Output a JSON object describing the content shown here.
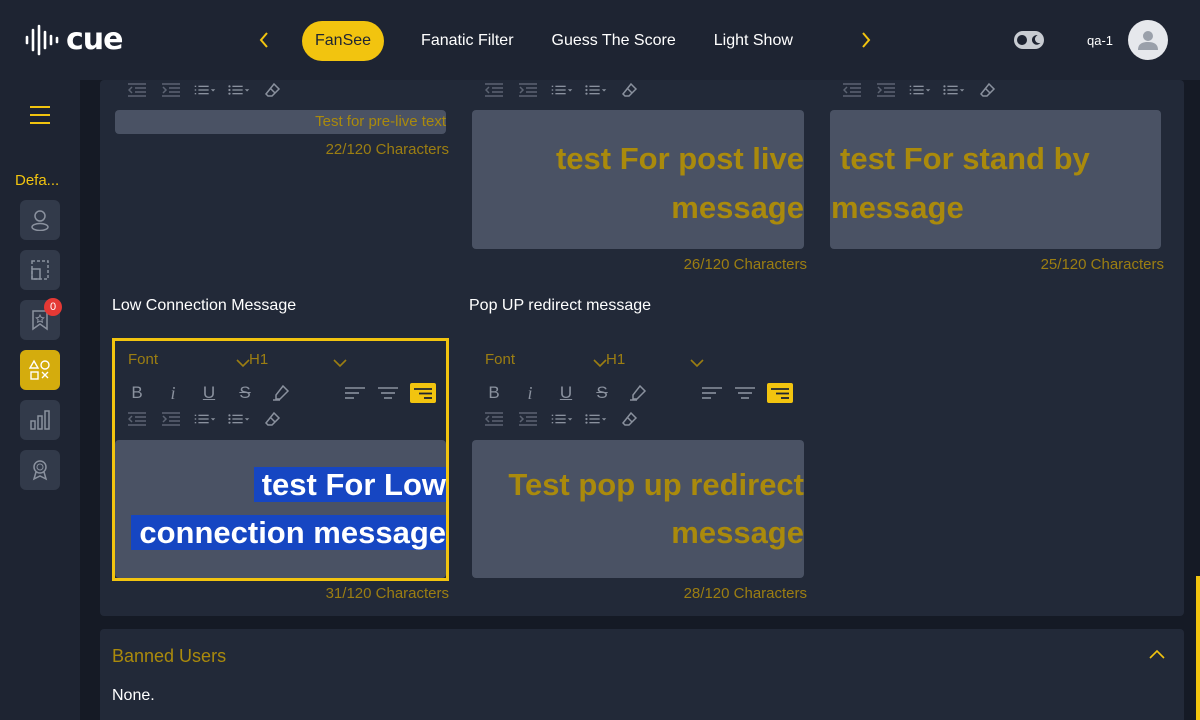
{
  "app": {
    "logo_text": "cue",
    "username": "qa-1"
  },
  "nav": {
    "tabs": [
      {
        "label": "FanSee",
        "active": true
      },
      {
        "label": "Fanatic Filter",
        "active": false
      },
      {
        "label": "Guess The Score",
        "active": false
      },
      {
        "label": "Light Show",
        "active": false
      }
    ]
  },
  "sidebar": {
    "label": "Defa...",
    "badge_count": "0",
    "items": [
      "user-icon",
      "layout-icon",
      "bookmark-icon",
      "shapes-icon",
      "bar-chart-icon",
      "award-icon"
    ],
    "active_index": 3
  },
  "editors": {
    "pre_live": {
      "text": "Test for pre-live text",
      "count": "22/120 Characters"
    },
    "post_live": {
      "line1": "test For post live",
      "line2": "message",
      "count": "26/120 Characters"
    },
    "stand_by": {
      "line1": "test For stand by",
      "line2": "message",
      "count": "25/120 Characters"
    },
    "low_connection": {
      "label": "Low Connection Message",
      "font": "Font",
      "heading": "H1",
      "line1": "test For Low",
      "line2": "connection message",
      "count": "31/120 Characters"
    },
    "popup_redirect": {
      "label": "Pop UP redirect message",
      "font": "Font",
      "heading": "H1",
      "line1": "Test pop up redirect",
      "line2": "message",
      "count": "28/120 Characters"
    }
  },
  "banned": {
    "title": "Banned Users",
    "value": "None."
  },
  "colors": {
    "accent": "#f2c40f",
    "background": "#1e2432",
    "panel": "#222938",
    "editor": "#4a5264",
    "selection": "#1646c2",
    "badge": "#e53935"
  }
}
